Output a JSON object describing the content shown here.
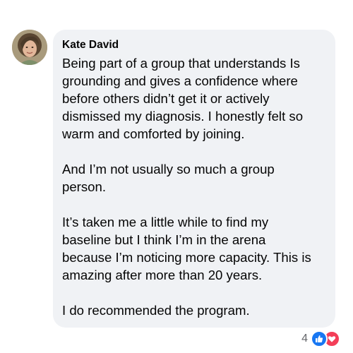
{
  "comment": {
    "author": "Kate David",
    "paragraphs": [
      {
        "lines": [
          "Being part of a group that understands Is",
          "grounding and gives a confidence where",
          "before others didn’t get it or actively",
          "dismissed my diagnosis. I honestly felt so",
          "warm and comforted by joining."
        ]
      },
      {
        "lines": [
          "And I’m not usually so much a group",
          "person."
        ]
      },
      {
        "lines": [
          "It’s taken me a little while to find my",
          "baseline but I think I’m in the arena",
          "because I’m noticing more capacity. This is",
          "amazing after more than 20 years."
        ]
      },
      {
        "lines": [
          "I do recommended the program."
        ]
      }
    ]
  },
  "reactions": {
    "count": "4",
    "types": [
      "like-icon",
      "love-icon"
    ],
    "like_color": "#1877f2",
    "love_color": "#f33e58"
  },
  "colors": {
    "bubble_background": "#f0f2f5",
    "text": "#050505",
    "meta_text": "#65676b"
  }
}
